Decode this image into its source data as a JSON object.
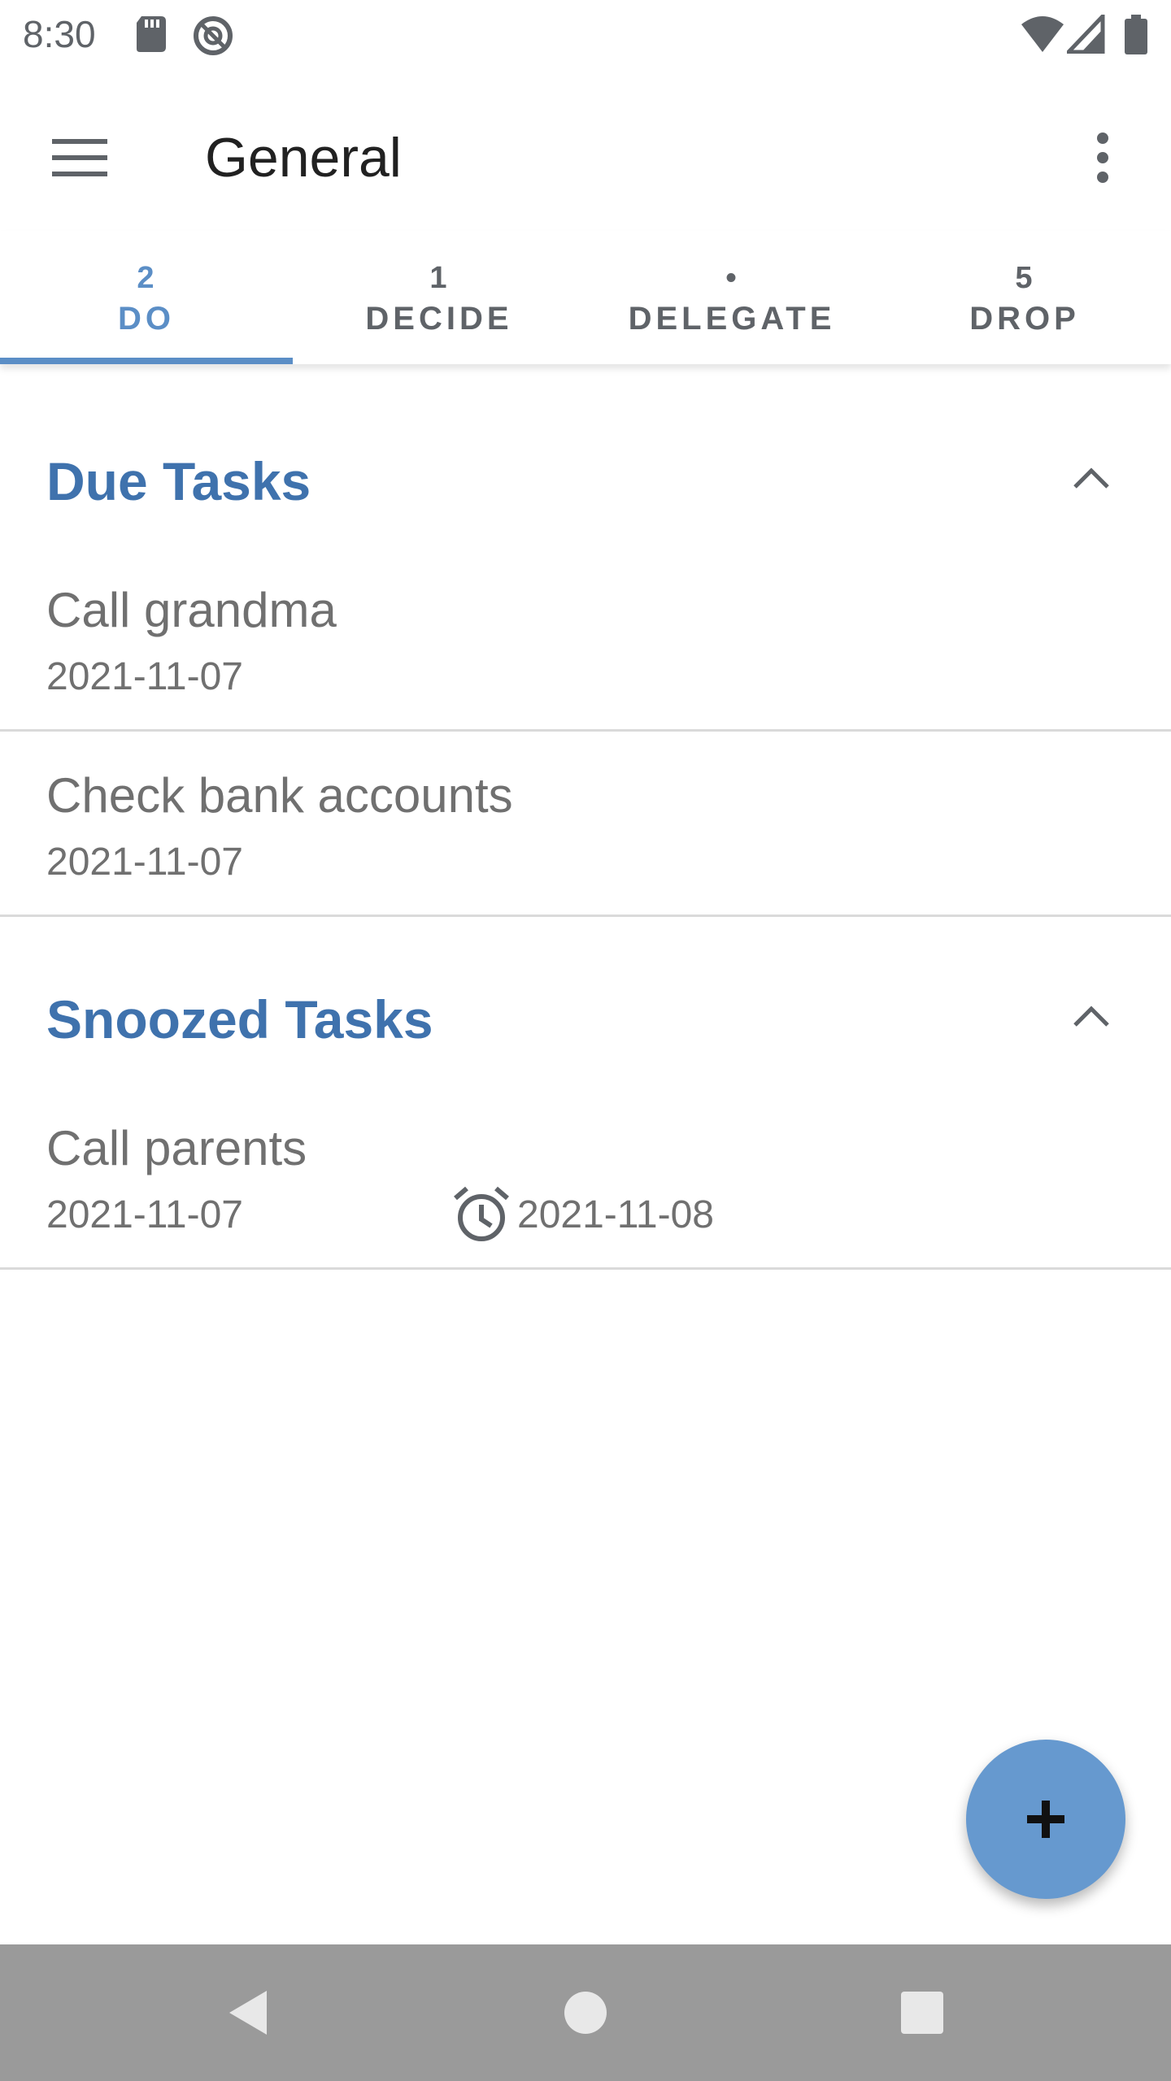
{
  "status_bar": {
    "time": "8:30",
    "icons": [
      "sd-card-icon",
      "sync-icon",
      "wifi-icon",
      "signal-icon",
      "battery-icon"
    ]
  },
  "app_bar": {
    "title": "General",
    "menu_icon": "hamburger-menu-icon",
    "overflow_icon": "more-vert-icon"
  },
  "tabs": [
    {
      "count": "2",
      "label": "DO",
      "active": true
    },
    {
      "count": "1",
      "label": "DECIDE",
      "active": false
    },
    {
      "count": "•",
      "label": "DELEGATE",
      "active": false
    },
    {
      "count": "5",
      "label": "DROP",
      "active": false
    }
  ],
  "sections": {
    "due": {
      "title": "Due Tasks",
      "tasks": [
        {
          "title": "Call grandma",
          "date": "2021-11-07"
        },
        {
          "title": "Check bank accounts",
          "date": "2021-11-07"
        }
      ]
    },
    "snoozed": {
      "title": "Snoozed Tasks",
      "tasks": [
        {
          "title": "Call parents",
          "date": "2021-11-07",
          "snooze_date": "2021-11-08"
        }
      ]
    }
  },
  "fab": {
    "icon": "plus-icon"
  },
  "colors": {
    "accent": "#5b8ec6",
    "section_title": "#3f72ad",
    "fab": "#6699cf",
    "nav_bar": "#9a9a9a"
  }
}
